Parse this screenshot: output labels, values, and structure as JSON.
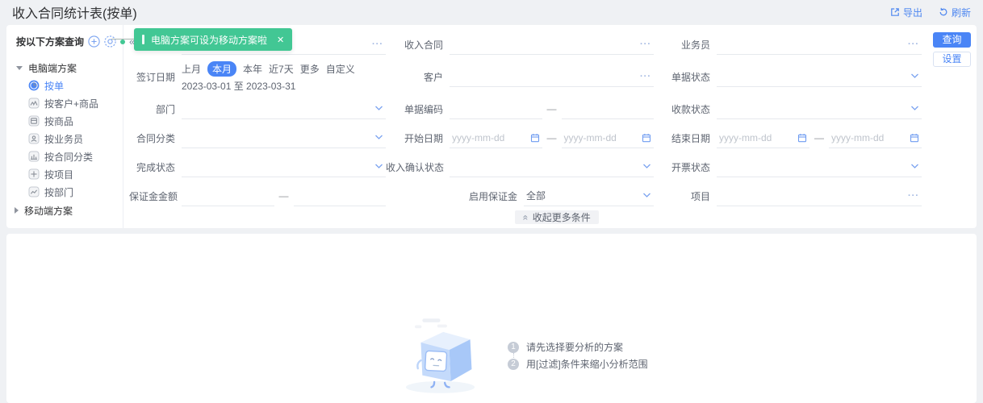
{
  "header": {
    "title": "收入合同统计表(按单)",
    "export": "导出",
    "refresh": "刷新"
  },
  "sidebar": {
    "header": "按以下方案查询",
    "pc_group": "电脑端方案",
    "mobile_group": "移动端方案",
    "items": [
      {
        "label": "按单",
        "selected": true
      },
      {
        "label": "按客户+商品"
      },
      {
        "label": "按商品"
      },
      {
        "label": "按业务员"
      },
      {
        "label": "按合同分类"
      },
      {
        "label": "按项目"
      },
      {
        "label": "按部门"
      }
    ]
  },
  "tooltip": {
    "text": "电脑方案可设为移动方案啦"
  },
  "actions": {
    "query": "查询",
    "settings": "设置"
  },
  "filters": {
    "unnamed": {
      "label": ""
    },
    "income_contract": {
      "label": "收入合同"
    },
    "salesperson": {
      "label": "业务员"
    },
    "sign_date": {
      "label": "签订日期",
      "options": [
        "上月",
        "本月",
        "本年",
        "近7天",
        "更多",
        "自定义"
      ],
      "selected": "本月",
      "range": "2023-03-01 至 2023-03-31"
    },
    "customer": {
      "label": "客户"
    },
    "doc_status": {
      "label": "单据状态"
    },
    "department": {
      "label": "部门"
    },
    "doc_code": {
      "label": "单据编码"
    },
    "collection_status": {
      "label": "收款状态"
    },
    "contract_category": {
      "label": "合同分类"
    },
    "start_date": {
      "label": "开始日期",
      "placeholder": "yyyy-mm-dd"
    },
    "end_date": {
      "label": "结束日期",
      "placeholder": "yyyy-mm-dd"
    },
    "completion_status": {
      "label": "完成状态"
    },
    "income_confirm_status": {
      "label": "收入确认状态"
    },
    "invoice_status": {
      "label": "开票状态"
    },
    "deposit_amount": {
      "label": "保证金金额"
    },
    "deposit_enabled": {
      "label": "启用保证金",
      "value": "全部"
    },
    "project": {
      "label": "项目"
    }
  },
  "glyphs": {
    "ellipsis": "···",
    "collapse": "«",
    "close": "✕",
    "range_dash": "—"
  },
  "collapse_bar": {
    "label": "收起更多条件"
  },
  "empty_state": {
    "steps": [
      {
        "num": "1",
        "text": "请先选择要分析的方案"
      },
      {
        "num": "2",
        "text": "用[过滤]条件来缩小分析范围"
      }
    ]
  },
  "colors": {
    "accent": "#4a85f6",
    "success": "#42c794"
  }
}
